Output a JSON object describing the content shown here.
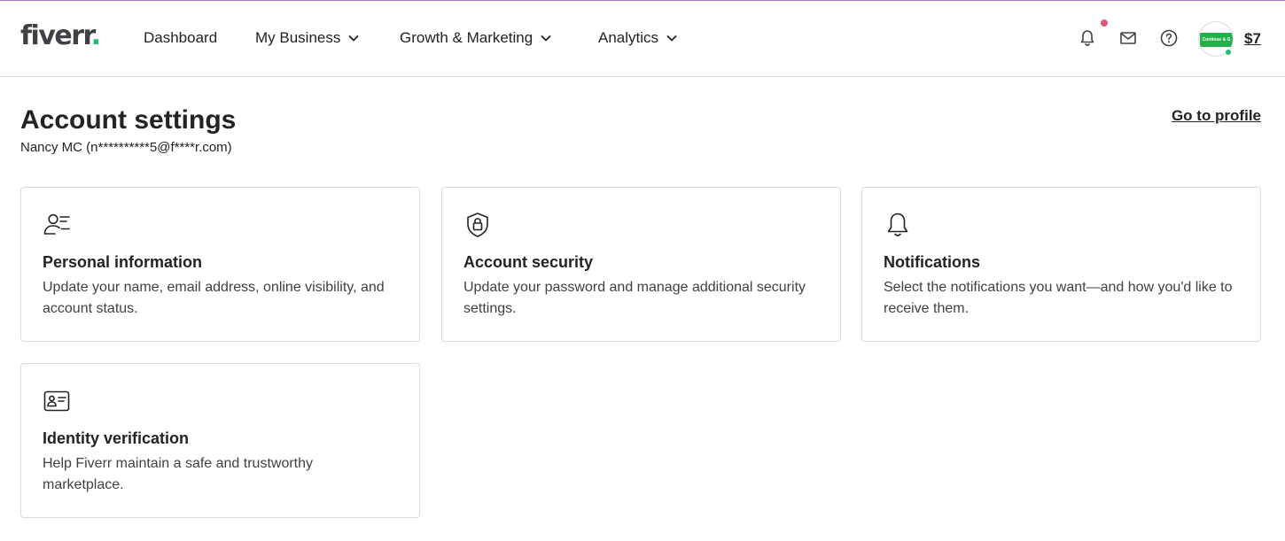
{
  "header": {
    "logo_text": "fiverr",
    "logo_dot": ".",
    "nav": [
      {
        "label": "Dashboard",
        "has_dropdown": false
      },
      {
        "label": "My Business",
        "has_dropdown": true
      },
      {
        "label": "Growth & Marketing",
        "has_dropdown": true
      },
      {
        "label": "Analytics",
        "has_dropdown": true
      }
    ],
    "icons": [
      "bell-icon",
      "envelope-icon",
      "help-circle-icon"
    ],
    "avatar_text": "Continue & G",
    "balance": "$7"
  },
  "page": {
    "title": "Account settings",
    "subtitle": "Nancy MC (n**********5@f****r.com)",
    "profile_link": "Go to profile"
  },
  "cards": [
    {
      "icon": "person-list-icon",
      "title": "Personal information",
      "description": "Update your name, email address, online visibility, and account status."
    },
    {
      "icon": "shield-lock-icon",
      "title": "Account security",
      "description": "Update your password and manage additional security settings."
    },
    {
      "icon": "bell-icon",
      "title": "Notifications",
      "description": "Select the notifications you want—and how you'd like to receive them."
    },
    {
      "icon": "id-card-icon",
      "title": "Identity verification",
      "description": "Help Fiverr maintain a safe and trustworthy marketplace."
    }
  ],
  "colors": {
    "brand_green": "#1dbf73",
    "notification_dot": "#e0577b",
    "text_primary": "#222325",
    "border": "#dadbdd"
  }
}
